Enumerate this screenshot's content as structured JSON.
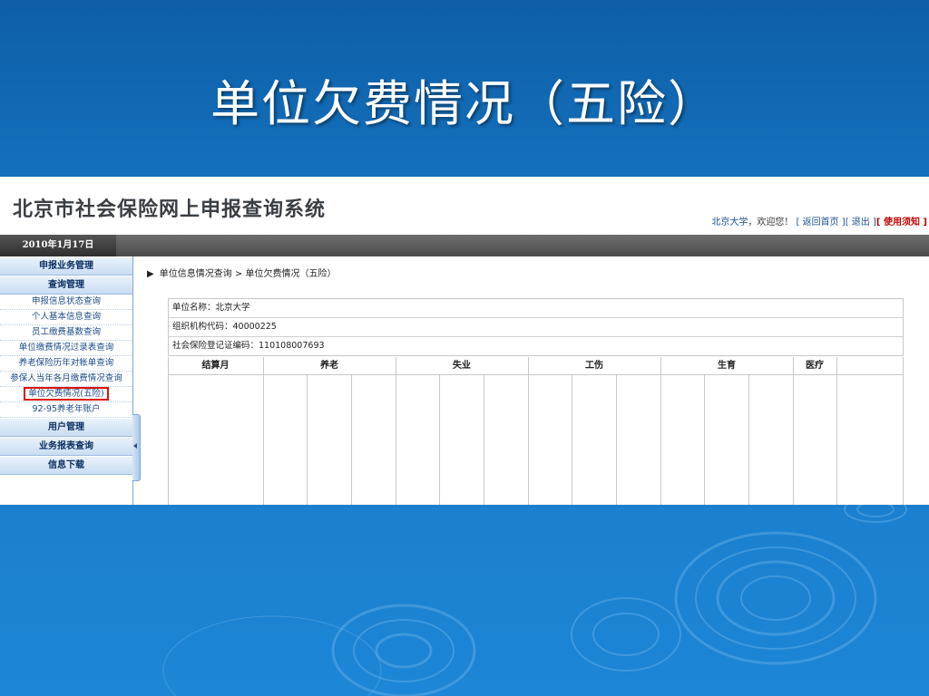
{
  "slide": {
    "title": "单位欠费情况（五险）"
  },
  "app": {
    "site_title": "北京市社会保险网上申报查询系统",
    "user_name": "北京大学",
    "welcome_text": "，欢迎您！",
    "links": [
      "[ 返回首页 ]",
      "[ 退出 ]",
      "[ 使用须知 ]"
    ],
    "date": "2010年1月17日"
  },
  "sidebar": {
    "items": [
      {
        "type": "head",
        "label": "申报业务管理"
      },
      {
        "type": "head",
        "label": "查询管理"
      },
      {
        "type": "sub",
        "label": "申报信息状态查询"
      },
      {
        "type": "sub",
        "label": "个人基本信息查询"
      },
      {
        "type": "sub",
        "label": "员工缴费基数查询"
      },
      {
        "type": "sub",
        "label": "单位缴费情况过录表查询"
      },
      {
        "type": "sub",
        "label": "养老保险历年对帐单查询"
      },
      {
        "type": "sub",
        "label": "参保人当年各月缴费情况查询"
      },
      {
        "type": "sub",
        "label": "单位欠费情况(五险)",
        "active": true
      },
      {
        "type": "sub",
        "label": "92-95养老年账户"
      },
      {
        "type": "head",
        "label": "用户管理"
      },
      {
        "type": "head",
        "label": "业务报表查询"
      },
      {
        "type": "head",
        "label": "信息下载"
      }
    ]
  },
  "main": {
    "breadcrumb": {
      "parent": "单位信息情况查询",
      "separator": ">",
      "current": "单位欠费情况（五险）"
    },
    "info_rows": [
      "单位名称：北京大学",
      "组织机构代码：40000225",
      "社会保险登记证编码：110108007693"
    ],
    "table": {
      "headers": [
        "结算月",
        "养老",
        "失业",
        "工伤",
        "生育",
        "医疗"
      ]
    }
  },
  "colors": {
    "slide_bg": "#1a74c0",
    "active_highlight": "#d11111",
    "notice_link": "#c00000",
    "nav_text": "#1d4b8a"
  },
  "icons": {
    "breadcrumb_arrow": "right-triangle-icon",
    "collapse_handle": "left-triangle-icon"
  }
}
